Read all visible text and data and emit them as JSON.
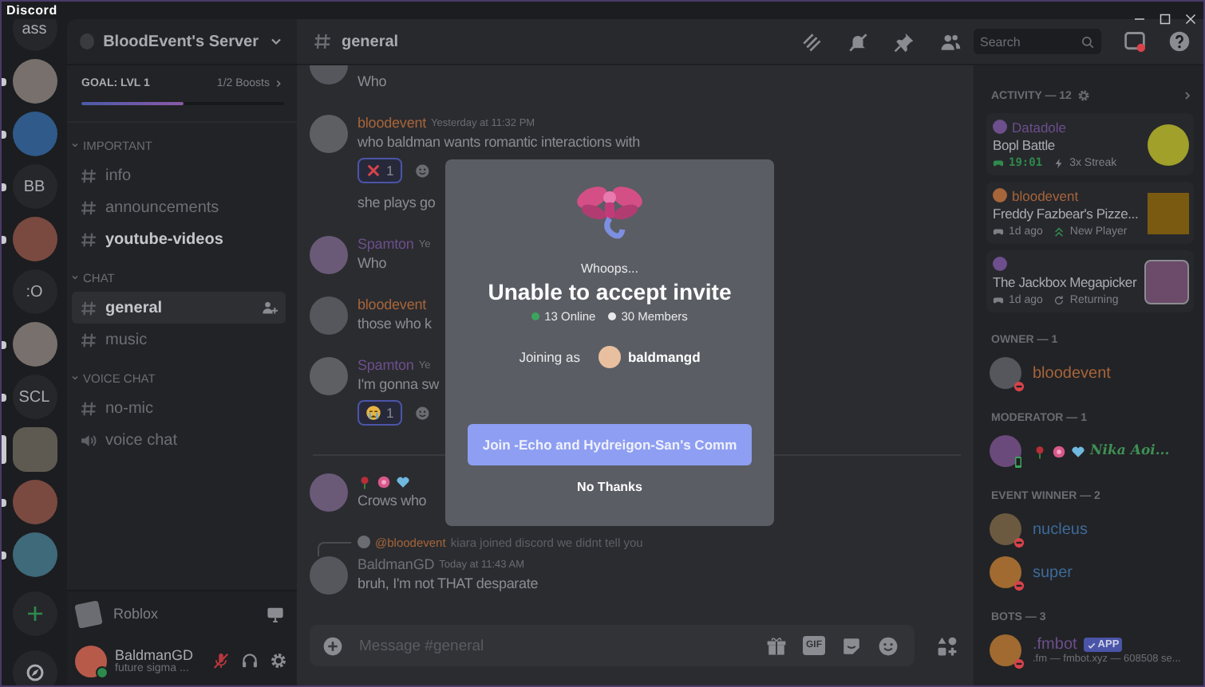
{
  "app": {
    "title": "Discord"
  },
  "servers": [
    {
      "kind": "text",
      "label": "ass",
      "unread": false,
      "selected": false
    },
    {
      "kind": "picture",
      "unread": true,
      "selected": false
    },
    {
      "kind": "picture",
      "unread": true,
      "selected": false
    },
    {
      "kind": "text",
      "label": "BB",
      "unread": true,
      "selected": false
    },
    {
      "kind": "picture",
      "unread": true,
      "selected": false
    },
    {
      "kind": "text",
      "label": ":O",
      "unread": false,
      "selected": false
    },
    {
      "kind": "picture",
      "unread": true,
      "selected": false
    },
    {
      "kind": "text",
      "label": "SCL",
      "unread": true,
      "selected": false
    },
    {
      "kind": "picture",
      "unread": false,
      "selected": true
    },
    {
      "kind": "picture",
      "unread": true,
      "selected": false
    },
    {
      "kind": "picture",
      "unread": true,
      "selected": false
    }
  ],
  "server": {
    "name": "BloodEvent's Server",
    "boost": {
      "goal": "GOAL: LVL 1",
      "count": "1/2 Boosts",
      "level": 0.5
    }
  },
  "categories": [
    {
      "name": "IMPORTANT",
      "expanded": true,
      "channels": [
        {
          "kind": "text",
          "name": "info",
          "unread": false,
          "selected": false
        },
        {
          "kind": "text",
          "name": "announcements",
          "unread": false,
          "selected": false
        },
        {
          "kind": "text",
          "name": "youtube-videos",
          "unread": true,
          "selected": false
        }
      ]
    },
    {
      "name": "CHAT",
      "expanded": true,
      "channels": [
        {
          "kind": "text",
          "name": "general",
          "unread": false,
          "selected": true
        },
        {
          "kind": "text",
          "name": "music",
          "unread": false,
          "selected": false
        }
      ]
    },
    {
      "name": "VOICE CHAT",
      "expanded": true,
      "channels": [
        {
          "kind": "text",
          "name": "no-mic",
          "unread": false,
          "selected": false
        },
        {
          "kind": "voice",
          "name": "voice chat",
          "unread": false,
          "selected": false
        }
      ]
    }
  ],
  "activity": {
    "game": "Roblox"
  },
  "user": {
    "name": "BaldmanGD",
    "status_text": "future sigma ...",
    "muted": true
  },
  "channel_header": {
    "name": "general",
    "search": {
      "placeholder": "Search"
    }
  },
  "messages": [
    {
      "kind": "tail",
      "lines": [
        "Who"
      ]
    },
    {
      "kind": "group",
      "author": "bloodevent",
      "color": "#a7653a",
      "time": "Yesterday at 11:32 PM",
      "lines": [
        "who baldman wants romantic interactions with"
      ],
      "reactions": [
        {
          "kind": "cross",
          "count": "1",
          "selected": true
        }
      ]
    },
    {
      "kind": "continuation",
      "lines": [
        "she plays go"
      ]
    },
    {
      "kind": "group",
      "author": "Spamton",
      "color": "#6c4f8c",
      "time": "Ye",
      "lines": [
        "Who"
      ]
    },
    {
      "kind": "group",
      "author": "bloodevent",
      "color": "#a7653a",
      "lines": [
        "those who k"
      ]
    },
    {
      "kind": "group",
      "author": "Spamton",
      "color": "#6c4f8c",
      "time": "Ye",
      "lines": [
        "I'm gonna sw"
      ],
      "reactions": [
        {
          "kind": "crying",
          "count": "1",
          "selected": true
        }
      ]
    },
    {
      "kind": "divider"
    },
    {
      "kind": "group",
      "badges": [
        {
          "kind": "rose"
        },
        {
          "kind": "flower"
        },
        {
          "kind": "heart"
        }
      ],
      "lines": [
        "Crows who"
      ]
    },
    {
      "kind": "group",
      "author": "BaldmanGD",
      "color": "#6f7177",
      "time": "Today at 11:43 AM",
      "reply": {
        "author": "@bloodevent",
        "color": "#a7653a",
        "text": "kiara joined discord we didnt tell you"
      },
      "lines": [
        "bruh, I'm not THAT desparate"
      ]
    }
  ],
  "composer": {
    "placeholder": "Message #general",
    "gif": "GIF"
  },
  "members": {
    "activity_title": "ACTIVITY — 12",
    "activities": [
      {
        "user": "Datadole",
        "color": "#6c4f8c",
        "game": "Bopl Battle",
        "time": "19:01",
        "live": true,
        "note": {
          "kind": "streak",
          "text": "3x Streak"
        }
      },
      {
        "user": "bloodevent",
        "color": "#a7653a",
        "game": "Freddy Fazbear's Pizze...",
        "time": "1d ago",
        "live": false,
        "note": {
          "kind": "new",
          "text": "New Player"
        }
      },
      {
        "color": "#6c4f8c",
        "game": "The Jackbox Megapicker",
        "time": "1d ago",
        "live": false,
        "note": {
          "kind": "returning",
          "text": "Returning"
        }
      }
    ],
    "groups": [
      {
        "title": "OWNER — 1",
        "members": [
          {
            "name": "bloodevent",
            "color": "#a7653a",
            "status": {
              "kind": "dnd"
            }
          }
        ]
      },
      {
        "title": "MODERATOR — 1",
        "members": [
          {
            "name": "Nika Aoi...",
            "badges": [
              {
                "kind": "rose"
              },
              {
                "kind": "flower"
              },
              {
                "kind": "heart"
              }
            ],
            "color": "#3f8f55",
            "status": {
              "kind": "mobile"
            },
            "fancy": true
          }
        ]
      },
      {
        "title": "EVENT WINNER — 2",
        "members": [
          {
            "name": "nucleus",
            "color": "#3d6a9a",
            "status": {
              "kind": "dnd"
            }
          },
          {
            "name": "super",
            "color": "#3d6a9a",
            "status": {
              "kind": "dnd"
            }
          }
        ]
      },
      {
        "title": "BOTS — 3",
        "members": [
          {
            "name": ".fmbot",
            "color": "#6c4f8c",
            "status": {
              "kind": "dnd"
            },
            "tag": "APP",
            "subtitle": ".fm — fmbot.xyz — 608508 se..."
          }
        ]
      }
    ]
  },
  "modal": {
    "kicker": "Whoops...",
    "title": "Unable to accept invite",
    "online": "13 Online",
    "members": "30 Members",
    "joining_label": "Joining as",
    "username": "baldmangd",
    "join_button": "Join -Echo and Hydreigon-San's Comm",
    "cancel": "No Thanks"
  }
}
